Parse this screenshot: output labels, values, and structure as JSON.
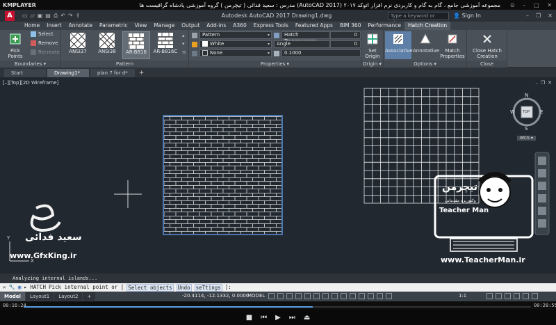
{
  "player": {
    "name": "KMPLAYER",
    "title": "مجموعه آموزشی جامع ، گام به گام و کاربردی نرم افزار   اتوکد ٢٠١٧ (AutoCAD 2017)   مدرس : سعید فدائی ( تیچرمن ) گروه آموزشی پادشاه گرافیست ها",
    "time_elapsed": "00:16:24",
    "time_total": "00:28:55",
    "progress": 0.57
  },
  "acad": {
    "app_letter": "A",
    "doc_title": "Autodesk AutoCAD 2017    Drawing1.dwg",
    "search_placeholder": "Type a keyword or phrase",
    "sign_in": "Sign In"
  },
  "ribbon_tabs": [
    "Home",
    "Insert",
    "Annotate",
    "Parametric",
    "View",
    "Manage",
    "Output",
    "Add-ins",
    "A360",
    "Express Tools",
    "Featured Apps",
    "BIM 360",
    "Performance",
    "Hatch Creation"
  ],
  "ribbon": {
    "boundaries": {
      "label": "Boundaries",
      "pick_points": "Pick Points",
      "select": "Select",
      "remove": "Remove",
      "recreate": "Recreate"
    },
    "pattern": {
      "label": "Pattern",
      "swatches": [
        "ANSI37",
        "ANSI38",
        "AR-B816",
        "AR-B816C"
      ]
    },
    "properties": {
      "label": "Properties",
      "type": "Pattern",
      "color": "White",
      "background": "None",
      "transparency_label": "Hatch Transparency",
      "transparency_value": "0",
      "angle_label": "Angle",
      "angle_value": "0",
      "scale_value": "0.1000"
    },
    "origin": {
      "label": "Origin",
      "set_origin": "Set Origin"
    },
    "options": {
      "label": "Options",
      "associative": "Associative",
      "annotative": "Annotative",
      "match_properties": "Match Properties"
    },
    "close": {
      "label": "Close",
      "close_hatch": "Close Hatch Creation"
    }
  },
  "file_tabs": [
    "Start",
    "Drawing1*",
    "plan 7 for d*"
  ],
  "viewport": {
    "label": "[–][Top][2D Wireframe]",
    "viewcube": {
      "top": "TOP",
      "n": "N",
      "s": "S",
      "e": "E",
      "w": "W",
      "wcs": "WCS"
    }
  },
  "watermarks": {
    "left_name": "سعید فدائی",
    "left_site": "www.GfxKing.ir",
    "right_brand": "تیچرمن",
    "right_brand_en": "Teacher Man",
    "right_sub": "وکتوریزه مقدماتی",
    "right_site": "www.TeacherMan.ir"
  },
  "command": {
    "history": "Analyzing internal islands...",
    "prompt_prefix": "HATCH",
    "prompt_text": "Pick internal point or [",
    "options": [
      "Select objects",
      "Undo",
      "seTtings"
    ],
    "prompt_suffix": "]:"
  },
  "status": {
    "layout_tabs": [
      "Model",
      "Layout1",
      "Layout2"
    ],
    "coords": "-20.4114, -12.1332, 0.0000",
    "space": "MODEL",
    "scale": "1:1"
  },
  "colors": {
    "canvas": "#212830",
    "selection": "#5a8fd8",
    "hatch": "#e6e6e6",
    "autocad_red": "#c8102e"
  }
}
